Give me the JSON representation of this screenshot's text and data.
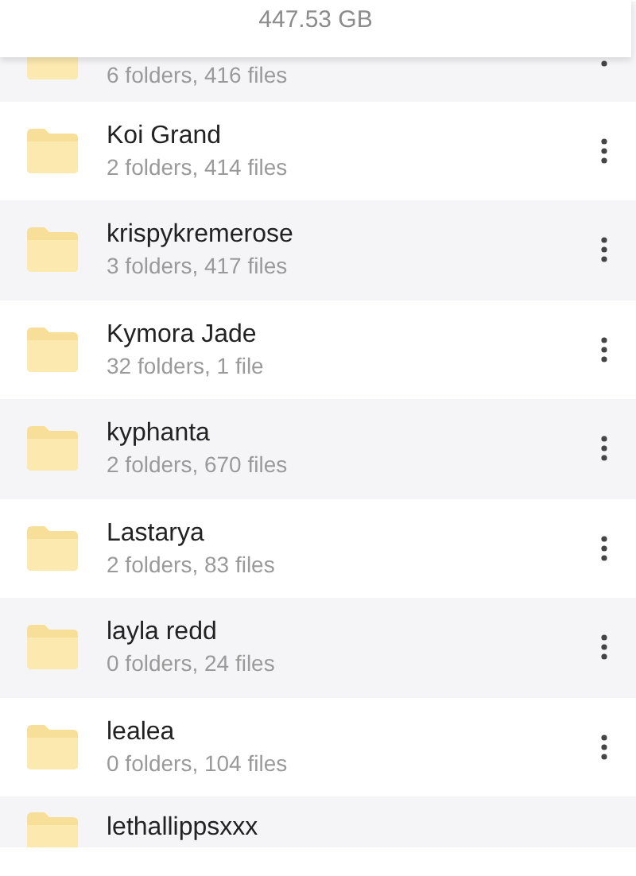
{
  "storage": {
    "size": "447.53 GB"
  },
  "folders": [
    {
      "subtitle": "6 folders, 416 files"
    },
    {
      "name": "Koi Grand",
      "subtitle": "2 folders, 414 files"
    },
    {
      "name": "krispykremerose",
      "subtitle": "3 folders, 417 files"
    },
    {
      "name": "Kymora Jade",
      "subtitle": "32 folders, 1 file"
    },
    {
      "name": "kyphanta",
      "subtitle": "2 folders, 670 files"
    },
    {
      "name": "Lastarya",
      "subtitle": "2 folders, 83 files"
    },
    {
      "name": "layla redd",
      "subtitle": "0 folders, 24 files"
    },
    {
      "name": "lealea",
      "subtitle": "0 folders, 104 files"
    },
    {
      "name": "lethallippsxxx"
    }
  ]
}
